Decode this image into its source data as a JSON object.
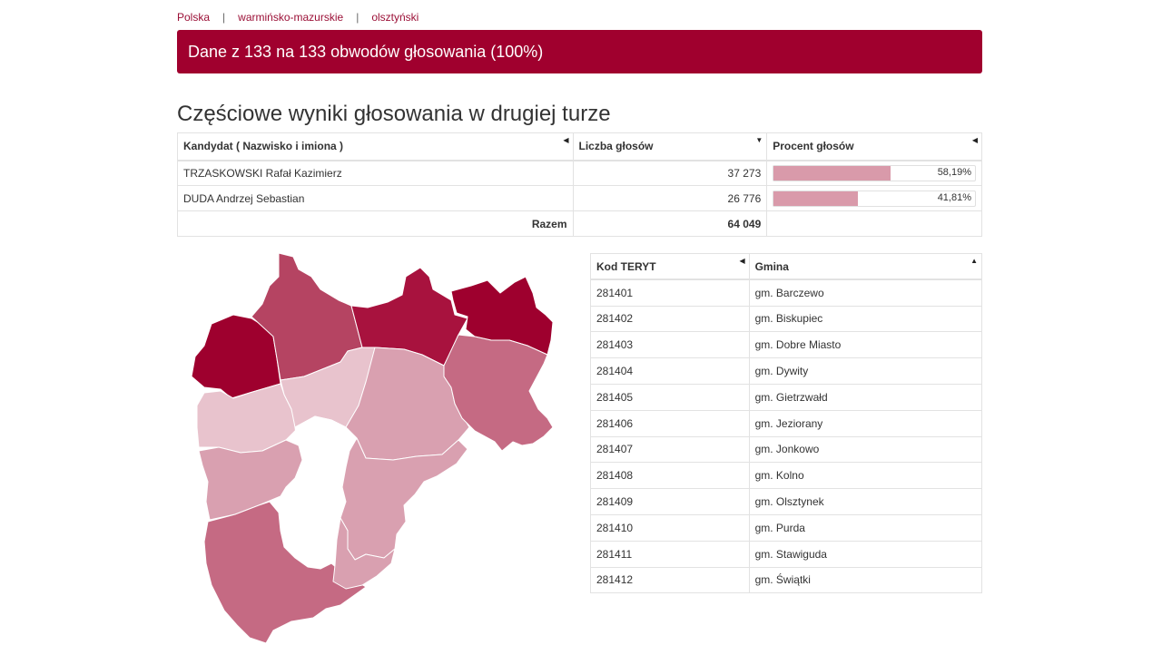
{
  "breadcrumb": [
    "Polska",
    "warmińsko-mazurskie",
    "olsztyński"
  ],
  "banner": "Dane z 133 na 133 obwodów głosowania (100%)",
  "section_title": "Częściowe wyniki głosowania w drugiej turze",
  "results": {
    "headers": [
      "Kandydat ( Nazwisko i imiona )",
      "Liczba głosów",
      "Procent głosów"
    ],
    "rows": [
      {
        "name": "TRZASKOWSKI Rafał Kazimierz",
        "votes": "37 273",
        "percent": "58,19%",
        "fraction": 0.5819
      },
      {
        "name": "DUDA Andrzej Sebastian",
        "votes": "26 776",
        "percent": "41,81%",
        "fraction": 0.4181
      }
    ],
    "total_label": "Razem",
    "total_votes": "64 049"
  },
  "gminy": {
    "headers": [
      "Kod TERYT",
      "Gmina"
    ],
    "rows": [
      {
        "code": "281401",
        "name": "gm. Barczewo"
      },
      {
        "code": "281402",
        "name": "gm. Biskupiec"
      },
      {
        "code": "281403",
        "name": "gm. Dobre Miasto"
      },
      {
        "code": "281404",
        "name": "gm. Dywity"
      },
      {
        "code": "281405",
        "name": "gm. Gietrzwałd"
      },
      {
        "code": "281406",
        "name": "gm. Jeziorany"
      },
      {
        "code": "281407",
        "name": "gm. Jonkowo"
      },
      {
        "code": "281408",
        "name": "gm. Kolno"
      },
      {
        "code": "281409",
        "name": "gm. Olsztynek"
      },
      {
        "code": "281410",
        "name": "gm. Purda"
      },
      {
        "code": "281411",
        "name": "gm. Stawiguda"
      },
      {
        "code": "281412",
        "name": "gm. Świątki"
      }
    ]
  },
  "colors": {
    "accent": "#a0002e",
    "bar": "#d99aaa",
    "map_shades": [
      "#9e002e",
      "#b54462",
      "#c56a83",
      "#d9a0b0",
      "#e8c3cd",
      "#ffffff"
    ]
  },
  "map_regions": [
    {
      "name": "northwest",
      "shade": "#9e002e"
    },
    {
      "name": "north-central-west",
      "shade": "#b54462"
    },
    {
      "name": "north-central",
      "shade": "#a8123e"
    },
    {
      "name": "northeast",
      "shade": "#9e002e"
    },
    {
      "name": "west",
      "shade": "#e8c3cd"
    },
    {
      "name": "center-north",
      "shade": "#e8c3cd"
    },
    {
      "name": "center",
      "shade": "#d9a0b0"
    },
    {
      "name": "east",
      "shade": "#c56a83"
    },
    {
      "name": "southwest-upper",
      "shade": "#d9a0b0"
    },
    {
      "name": "olsztyn-city",
      "shade": "#ffffff"
    },
    {
      "name": "south-center",
      "shade": "#d9a0b0"
    },
    {
      "name": "southwest",
      "shade": "#c56a83"
    },
    {
      "name": "south",
      "shade": "#d9a0b0"
    }
  ]
}
